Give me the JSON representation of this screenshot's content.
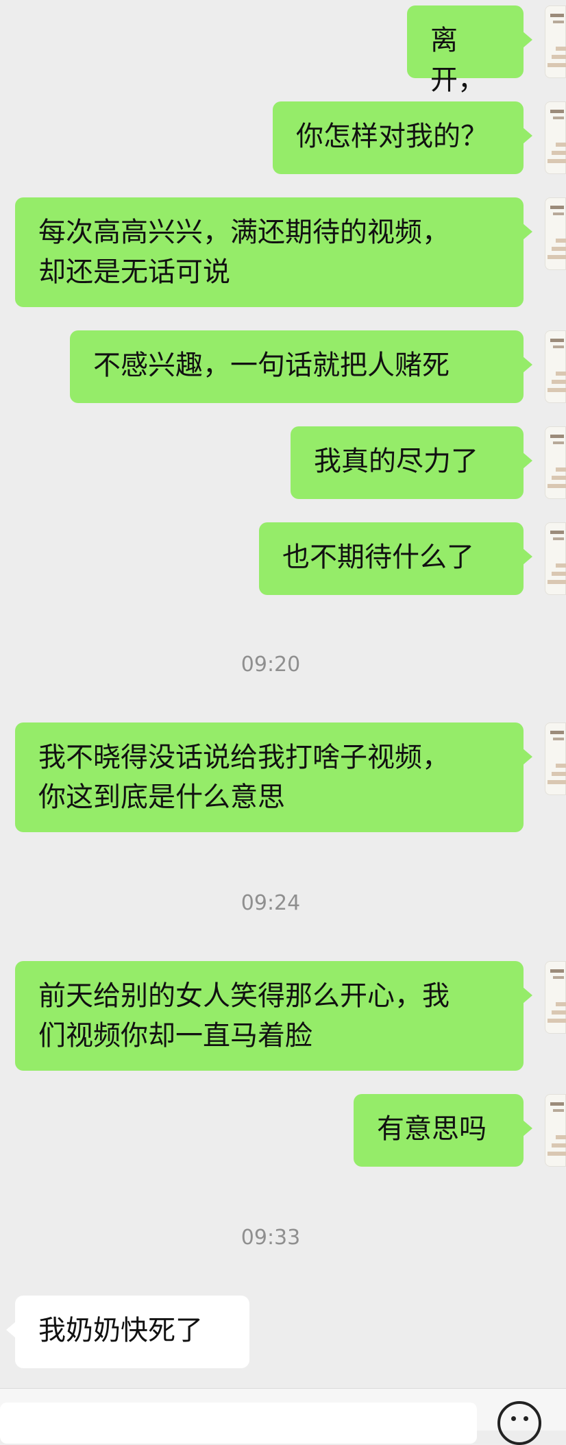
{
  "messages": [
    {
      "side": "right",
      "text": "离开，"
    },
    {
      "side": "right",
      "text": "你怎样对我的？"
    },
    {
      "side": "right",
      "text": "每次高高兴兴，满还期待的视频，\n却还是无话可说"
    },
    {
      "side": "right",
      "text": "不感兴趣，一句话就把人赌死"
    },
    {
      "side": "right",
      "text": "我真的尽力了"
    },
    {
      "side": "right",
      "text": "也不期待什么了"
    },
    {
      "side": "right",
      "text": "我不晓得没话说给我打啥子视频，\n你这到底是什么意思"
    },
    {
      "side": "right",
      "text": "前天给别的女人笑得那么开心，我\n们视频你却一直马着脸"
    },
    {
      "side": "right",
      "text": "有意思吗"
    },
    {
      "side": "left",
      "text": "我奶奶快死了"
    }
  ],
  "timestamps": [
    "09:20",
    "09:24",
    "09:33"
  ],
  "input": {
    "placeholder": "",
    "emoji_icon": "emoji-icon"
  },
  "colors": {
    "background": "#ededed",
    "sent_bubble": "#95ec69",
    "received_bubble": "#ffffff",
    "timestamp": "#8f8f8f"
  }
}
